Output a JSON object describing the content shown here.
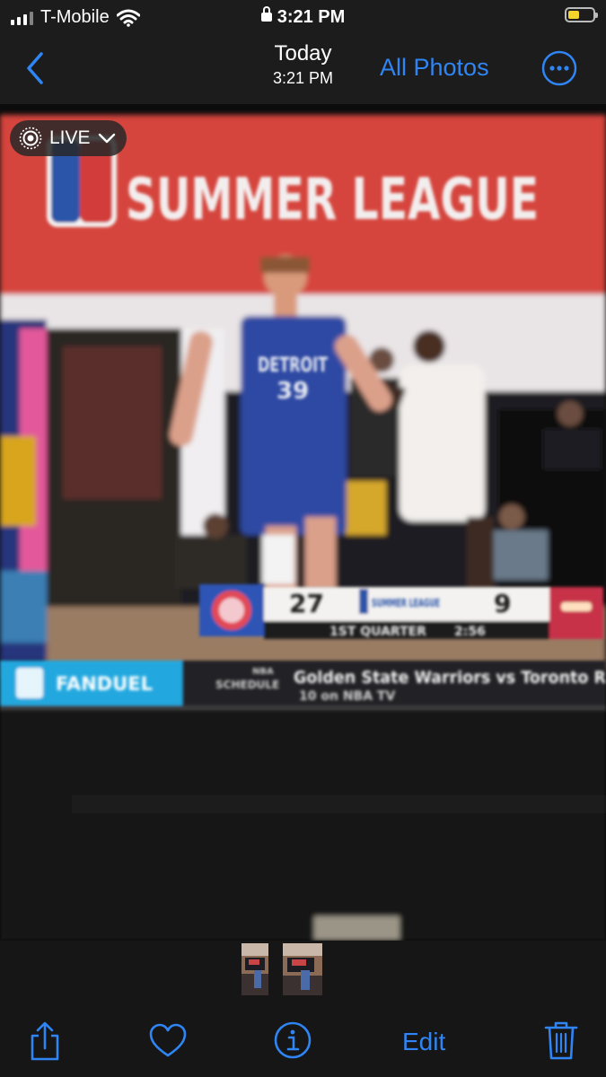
{
  "status_bar": {
    "carrier": "T-Mobile",
    "time": "3:21 PM"
  },
  "nav": {
    "title": "Today",
    "subtitle": "3:21 PM",
    "all_photos": "All Photos"
  },
  "photo": {
    "live_label": "LIVE",
    "banner": "SUMMER LEAGUE",
    "jersey_text": "DETROIT",
    "jersey_number": "39",
    "scorebug": {
      "home_score": "27",
      "league": "SUMMER LEAGUE",
      "away_score": "9",
      "period": "1ST QUARTER",
      "clock": "2:56"
    },
    "ticker": {
      "sponsor": "FANDUEL",
      "section_line1": "NBA",
      "section_line2": "SCHEDULE",
      "headline": "Golden State Warriors vs Toronto R",
      "subline": "10 on NBA TV"
    }
  },
  "toolbar": {
    "edit": "Edit"
  },
  "colors": {
    "accent": "#2f85f3",
    "battery": "#f4d32b",
    "bar_background": "#1c1c1c"
  }
}
